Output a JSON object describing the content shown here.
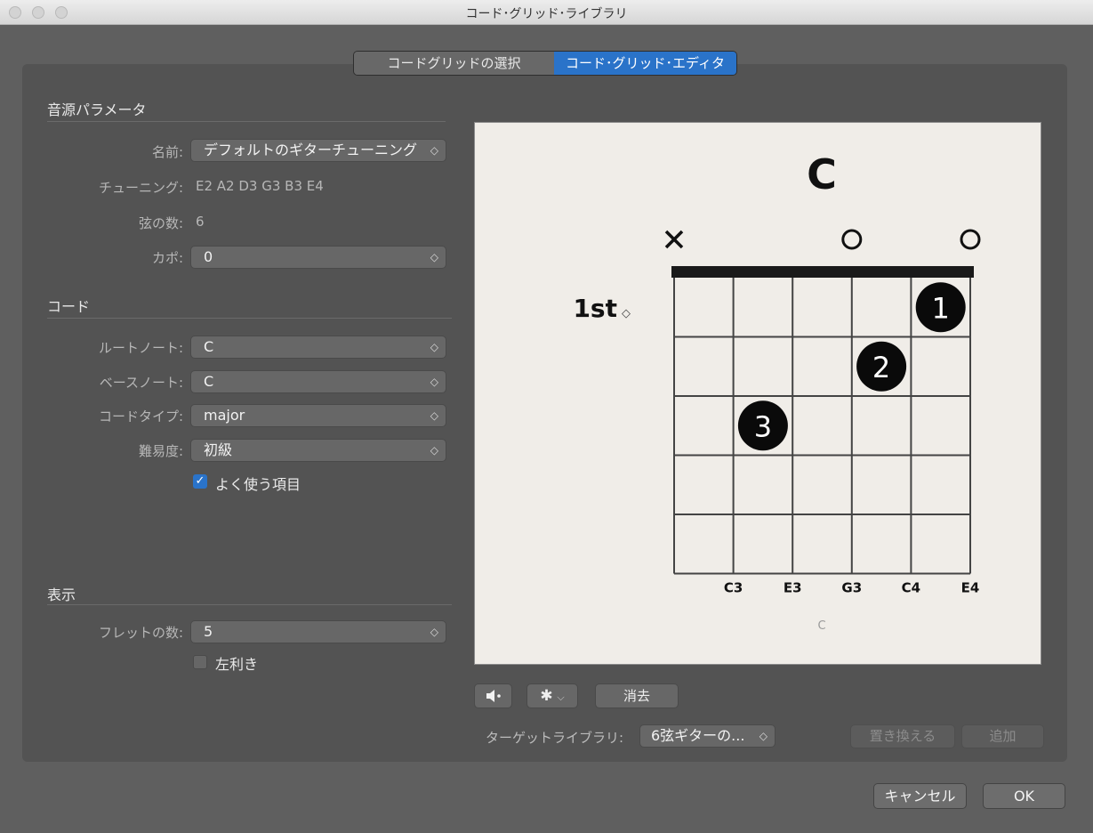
{
  "window": {
    "title": "コード･グリッド･ライブラリ"
  },
  "tabs": [
    {
      "label": "コードグリッドの選択",
      "active": false
    },
    {
      "label": "コード･グリッド･エディタ",
      "active": true
    }
  ],
  "instrument": {
    "section_title": "音源パラメータ",
    "name_label": "名前:",
    "name_value": "デフォルトのギターチューニング",
    "tuning_label": "チューニング:",
    "tuning_value": "E2 A2 D3 G3 B3 E4",
    "strings_label": "弦の数:",
    "strings_value": "6",
    "capo_label": "カポ:",
    "capo_value": "0"
  },
  "chord": {
    "section_title": "コード",
    "root_label": "ルートノート:",
    "root_value": "C",
    "bass_label": "ベースノート:",
    "bass_value": "C",
    "type_label": "コードタイプ:",
    "type_value": "major",
    "difficulty_label": "難易度:",
    "difficulty_value": "初級",
    "favorite_label": "よく使う項目",
    "favorite_checked": true
  },
  "display": {
    "section_title": "表示",
    "frets_label": "フレットの数:",
    "frets_value": "5",
    "lefthand_label": "左利き",
    "lefthand_checked": false
  },
  "grid": {
    "chord_name": "C",
    "position_label": "1st",
    "string_markers": [
      "x",
      "",
      "",
      "o",
      "",
      "o"
    ],
    "fingers": [
      {
        "string": 5,
        "fret": 1,
        "finger": "1"
      },
      {
        "string": 4,
        "fret": 2,
        "finger": "2"
      },
      {
        "string": 2,
        "fret": 3,
        "finger": "3"
      }
    ],
    "notes": [
      "",
      "C3",
      "E3",
      "G3",
      "C4",
      "E4"
    ],
    "caption": "C",
    "num_frets": 5,
    "num_strings": 6
  },
  "toolbar": {
    "clear_label": "消去",
    "target_library_label": "ターゲットライブラリ:",
    "target_library_value": "6弦ギターの...",
    "replace_label": "置き換える",
    "add_label": "追加"
  },
  "footer": {
    "cancel_label": "キャンセル",
    "ok_label": "OK"
  },
  "icons": {
    "speaker": "speaker-icon",
    "gear": "gear-icon"
  },
  "colors": {
    "accent": "#2a73c9",
    "panel": "#535353",
    "chart_bg": "#f0ede8"
  }
}
